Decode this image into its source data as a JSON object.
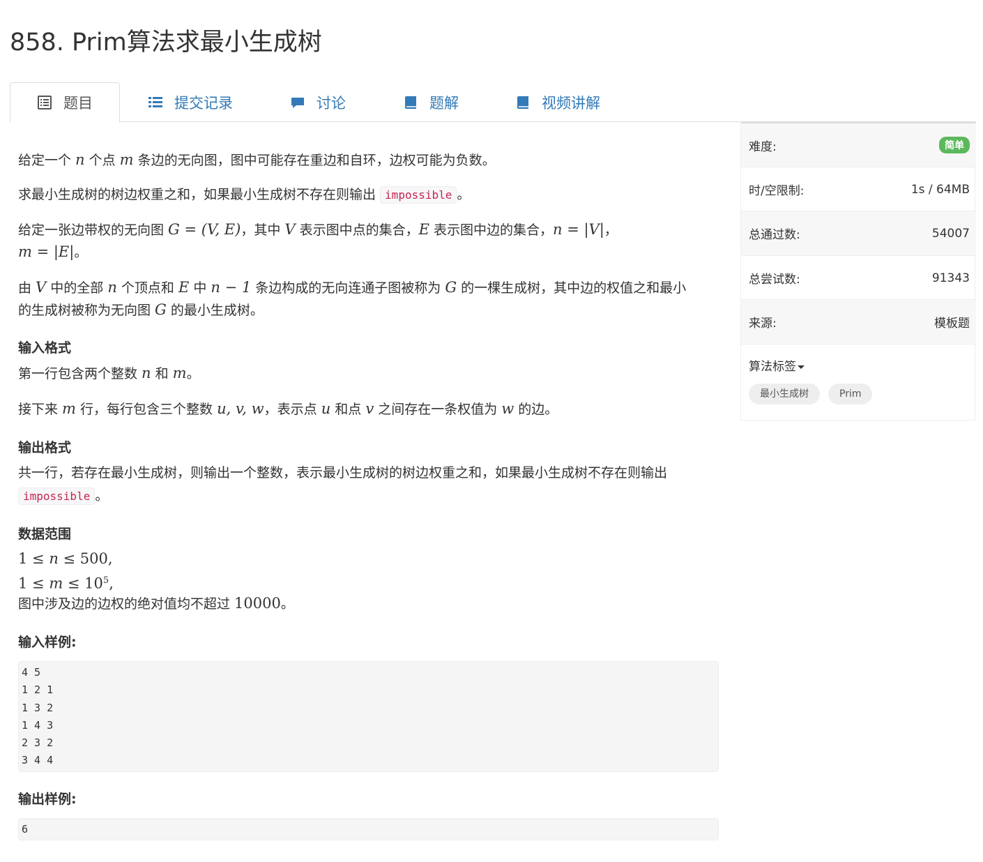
{
  "title": "858. Prim算法求最小生成树",
  "tabs": [
    {
      "label": "题目",
      "icon": "list-alt-icon"
    },
    {
      "label": "提交记录",
      "icon": "list-icon"
    },
    {
      "label": "讨论",
      "icon": "comment-icon"
    },
    {
      "label": "题解",
      "icon": "book-icon"
    },
    {
      "label": "视频讲解",
      "icon": "book-icon"
    }
  ],
  "problem": {
    "p1": {
      "a": "给定一个 ",
      "b": " 个点 ",
      "c": " 条边的无向图，图中可能存在重边和自环，边权可能为负数。",
      "n": "n",
      "m": "m"
    },
    "p2": {
      "a": "求最小生成树的树边权重之和，如果最小生成树不存在则输出 ",
      "code": "impossible",
      "b": "。"
    },
    "p3": {
      "a": "给定一张边带权的无向图 ",
      "graph": "G = (V, E)",
      "b": "，其中 ",
      "V": "V",
      "c": " 表示图中点的集合，",
      "E": "E",
      "d": " 表示图中边的集合，",
      "n_eq": "n = |V|",
      "e": "，",
      "m_eq": "m = |E|",
      "f": "。"
    },
    "p4": {
      "a": "由 ",
      "V": "V",
      "b": " 中的全部 ",
      "n": "n",
      "c": " 个顶点和 ",
      "E": "E",
      "d": " 中 ",
      "n1": "n − 1",
      "e": " 条边构成的无向连通子图被称为 ",
      "G": "G",
      "f": " 的一棵生成树，其中边的权值之和最小",
      "g": "的生成树被称为无向图 ",
      "G2": "G",
      "h": " 的最小生成树。"
    },
    "input_heading": "输入格式",
    "input_p1": {
      "a": "第一行包含两个整数 ",
      "n": "n",
      "b": " 和 ",
      "m": "m",
      "c": "。"
    },
    "input_p2": {
      "a": "接下来 ",
      "m": "m",
      "b": " 行，每行包含三个整数 ",
      "uvw": "u, v, w",
      "c": "，表示点 ",
      "u": "u",
      "d": " 和点 ",
      "v": "v",
      "e": " 之间存在一条权值为 ",
      "w": "w",
      "f": " 的边。"
    },
    "output_heading": "输出格式",
    "output_p": {
      "a": "共一行，若存在最小生成树，则输出一个整数，表示最小生成树的树边权重之和，如果最小生成树不存在则输出",
      "code": "impossible",
      "b": "。"
    },
    "range_heading": "数据范围",
    "range1": {
      "pre": "1 ≤ ",
      "v": "n",
      "post": " ≤ 500,"
    },
    "range2": {
      "pre": "1 ≤ ",
      "v": "m",
      "mid": " ≤ 10",
      "sup": "5",
      "post": ","
    },
    "range3": {
      "a": "图中涉及边的边权的绝对值均不超过 ",
      "num": "10000",
      "b": "。"
    },
    "sample_in_heading": "输入样例:",
    "sample_in": "4 5\n1 2 1\n1 3 2\n1 4 3\n2 3 2\n3 4 4",
    "sample_out_heading": "输出样例:",
    "sample_out": "6"
  },
  "side": {
    "difficulty_label": "难度:",
    "difficulty_value": "简单",
    "difficulty_color": "#5cb85c",
    "limit_label": "时/空限制:",
    "limit_value": "1s / 64MB",
    "passed_label": "总通过数:",
    "passed_value": "54007",
    "tried_label": "总尝试数:",
    "tried_value": "91343",
    "source_label": "来源:",
    "source_value": "模板题",
    "tags_label": "算法标签",
    "tags": [
      "最小生成树",
      "Prim"
    ]
  }
}
